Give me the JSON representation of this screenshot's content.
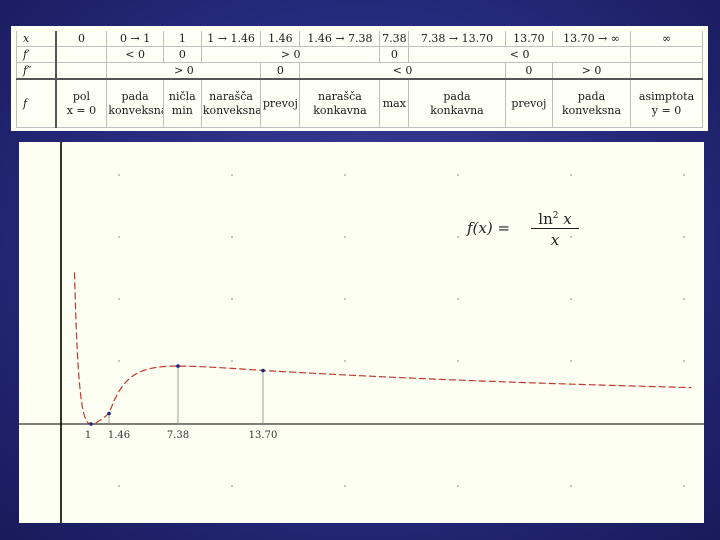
{
  "sign_table": {
    "row_x": {
      "label": "x",
      "cells": [
        "0",
        "0 → 1",
        "1",
        "1 → 1.46",
        "1.46",
        "1.46 → 7.38",
        "7.38",
        "7.38 → 13.70",
        "13.70",
        "13.70 → ∞",
        "∞"
      ]
    },
    "row_f1": {
      "label": "f′",
      "cells": [
        "",
        "< 0",
        "0",
        "> 0",
        "0",
        "< 0",
        ""
      ]
    },
    "row_f2": {
      "label": "f″",
      "cells": [
        "",
        "> 0",
        "0",
        "< 0",
        "0",
        "> 0",
        ""
      ]
    },
    "row_f": {
      "label": "f",
      "cells": [
        {
          "l1": "pol",
          "l2": "x = 0"
        },
        {
          "l1": "pada",
          "l2": "konveksna"
        },
        {
          "l1": "ničla",
          "l2": "min"
        },
        {
          "l1": "narašča",
          "l2": "konveksna"
        },
        {
          "l1": "prevoj",
          "l2": ""
        },
        {
          "l1": "narašča",
          "l2": "konkavna"
        },
        {
          "l1": "max",
          "l2": ""
        },
        {
          "l1": "pada",
          "l2": "konkavna"
        },
        {
          "l1": "prevoj",
          "l2": ""
        },
        {
          "l1": "pada",
          "l2": "konveksna"
        },
        {
          "l1": "asimptota",
          "l2": "y = 0"
        }
      ]
    }
  },
  "graph": {
    "formula": {
      "lhs": "f(x) =",
      "num_base": "ln",
      "num_exp": "2",
      "num_var": " x",
      "den": "x"
    },
    "x_tick_labels": [
      "1",
      "1.46",
      "7.38",
      "13.70"
    ],
    "curve_color": "#c0392b",
    "marker_color": "#1a237e"
  },
  "chart_data": {
    "type": "line",
    "title": "",
    "function": "f(x) = ln^2 x / x",
    "x": [
      0.45,
      0.6,
      0.8,
      1.0,
      1.2,
      1.46,
      2,
      3,
      4,
      5,
      7.38,
      9,
      11,
      13.7,
      17,
      20,
      25,
      30,
      35,
      40
    ],
    "y": [
      1.41,
      0.435,
      0.062,
      0.0,
      0.028,
      0.098,
      0.24,
      0.403,
      0.48,
      0.518,
      0.541,
      0.536,
      0.523,
      0.499,
      0.472,
      0.449,
      0.415,
      0.385,
      0.361,
      0.34
    ],
    "special_points": [
      {
        "x": 1,
        "label": "1"
      },
      {
        "x": 1.46,
        "label": "1.46"
      },
      {
        "x": 7.38,
        "label": "7.38"
      },
      {
        "x": 13.7,
        "label": "13.70"
      }
    ],
    "asymptotes": [
      "x = 0",
      "y = 0"
    ],
    "grid": "dotted"
  }
}
